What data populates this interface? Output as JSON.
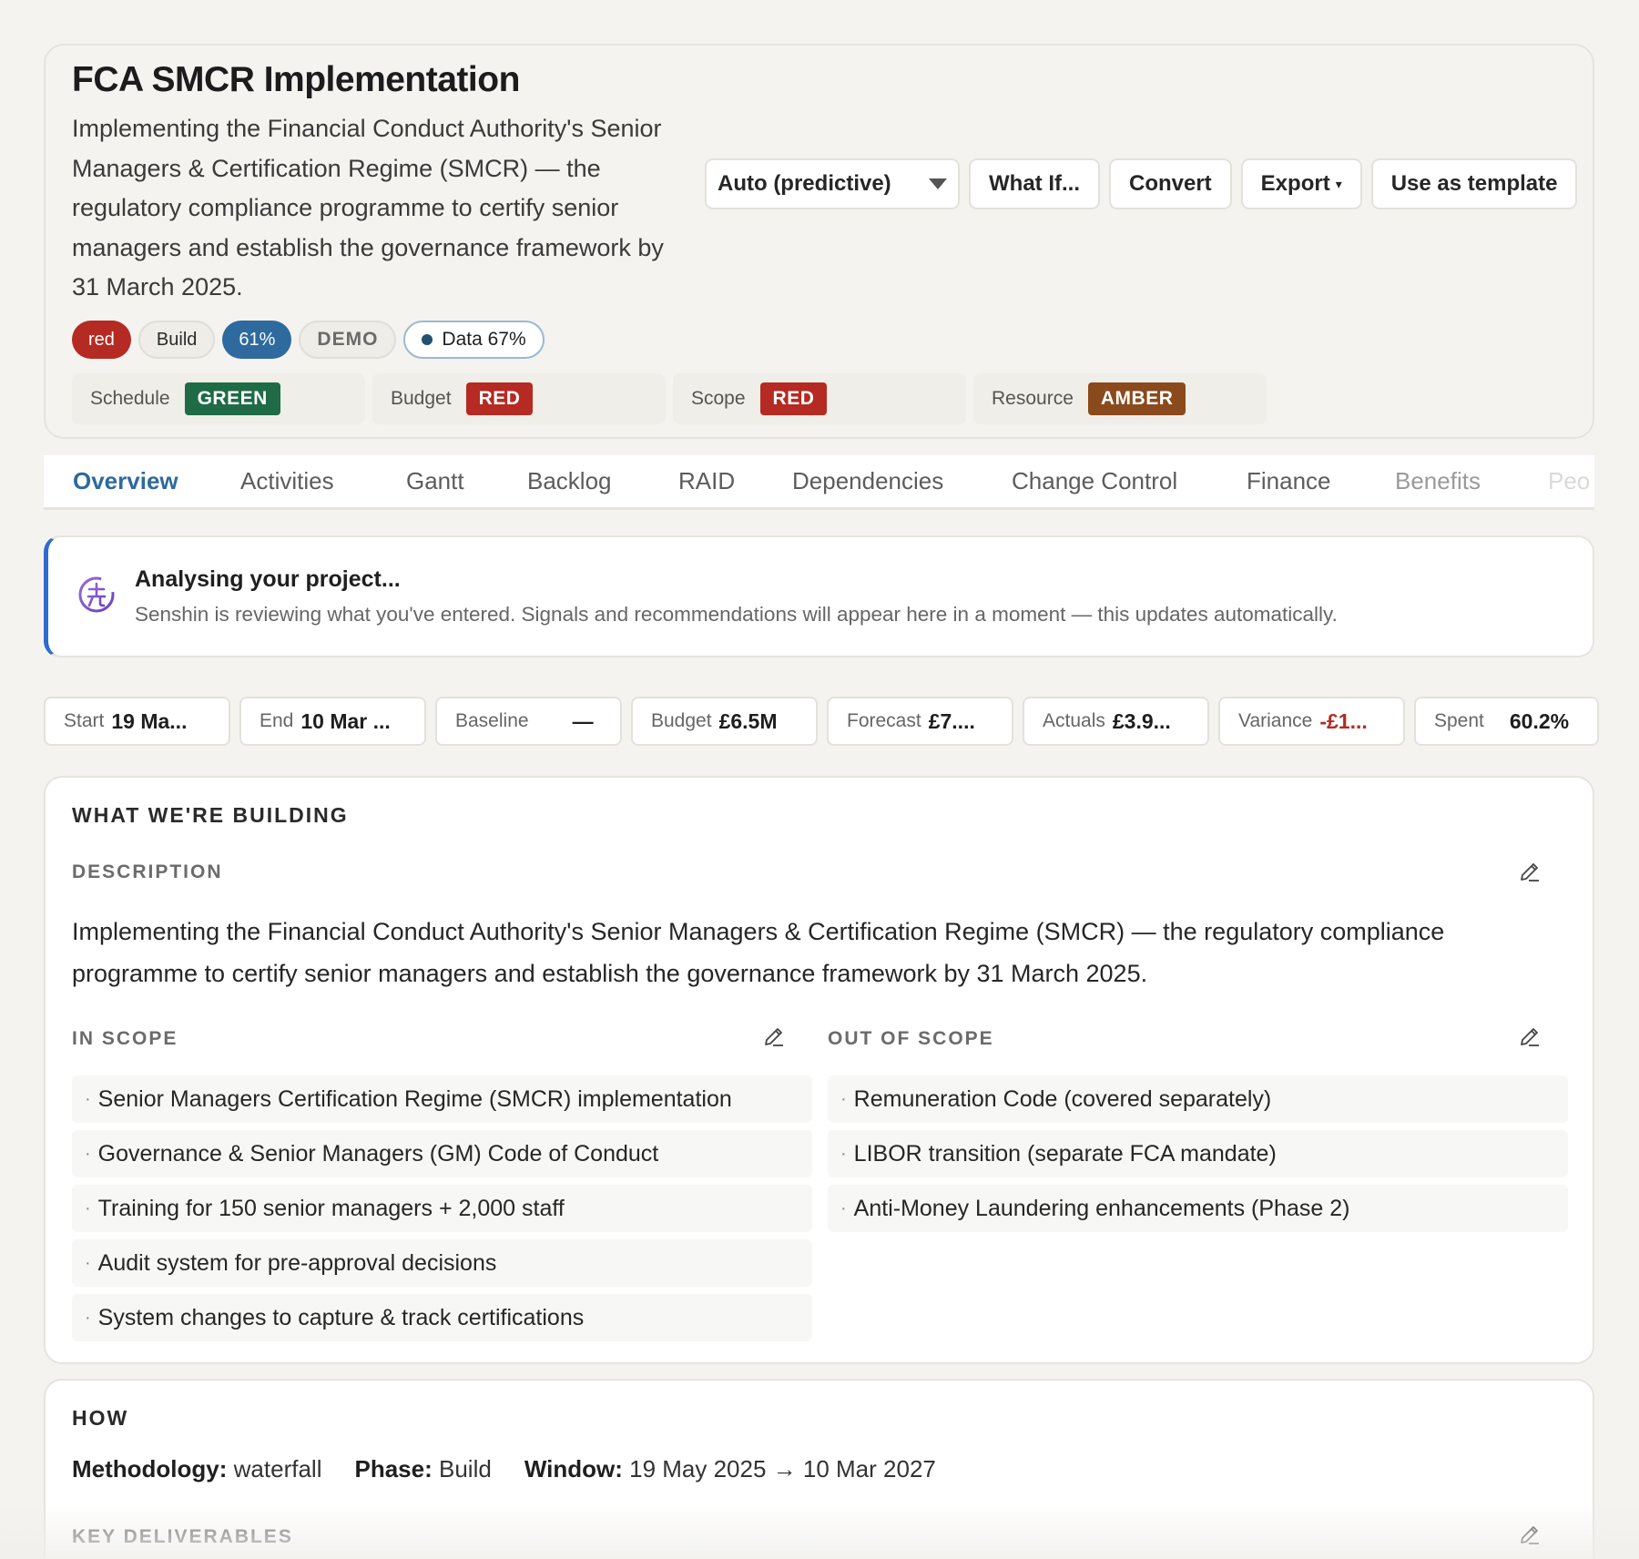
{
  "project": {
    "title": "FCA SMCR Implementation",
    "description": "Implementing the Financial Conduct Authority's Senior Managers & Certification Regime (SMCR) — the regulatory compliance programme to certify senior managers and establish the governance framework by 31 March 2025."
  },
  "toolbar": {
    "mode_select": "Auto (predictive)",
    "what_if": "What If...",
    "convert": "Convert",
    "export": "Export",
    "export_caret": "▾",
    "use_template": "Use as template"
  },
  "pills": {
    "status": "red",
    "phase": "Build",
    "progress": "61%",
    "demo": "DEMO",
    "data_quality": "Data 67%"
  },
  "rag": [
    {
      "label": "Schedule",
      "value": "GREEN",
      "color": "#1e6b45"
    },
    {
      "label": "Budget",
      "value": "RED",
      "color": "#b52a22"
    },
    {
      "label": "Scope",
      "value": "RED",
      "color": "#b52a22"
    },
    {
      "label": "Resource",
      "value": "AMBER",
      "color": "#8a4a1c"
    }
  ],
  "tabs": [
    "Overview",
    "Activities",
    "Gantt",
    "Backlog",
    "RAID",
    "Dependencies",
    "Change Control",
    "Finance",
    "Benefits",
    "Peo"
  ],
  "banner": {
    "title": "Analysing your project...",
    "text": "Senshin is reviewing what you've entered. Signals and recommendations will appear here in a moment — this updates automatically."
  },
  "metrics": [
    {
      "label": "Start",
      "value": "19 Ma..."
    },
    {
      "label": "End",
      "value": "10 Mar ..."
    },
    {
      "label": "Baseline",
      "value": "—"
    },
    {
      "label": "Budget",
      "value": "£6.5M"
    },
    {
      "label": "Forecast",
      "value": "£7...."
    },
    {
      "label": "Actuals",
      "value": "£3.9..."
    },
    {
      "label": "Variance",
      "value": "-£1..."
    },
    {
      "label": "Spent",
      "value": "60.2%"
    }
  ],
  "building": {
    "heading": "WHAT WE'RE BUILDING",
    "description_label": "DESCRIPTION",
    "description": "Implementing the Financial Conduct Authority's Senior Managers & Certification Regime (SMCR) — the regulatory compliance programme to certify senior managers and establish the governance framework by 31 March 2025.",
    "in_scope_label": "IN SCOPE",
    "out_scope_label": "OUT OF SCOPE",
    "in_scope": [
      "Senior Managers Certification Regime (SMCR) implementation",
      "Governance & Senior Managers (GM) Code of Conduct",
      "Training for 150 senior managers + 2,000 staff",
      "Audit system for pre-approval decisions",
      "System changes to capture & track certifications"
    ],
    "out_scope": [
      "Remuneration Code (covered separately)",
      "LIBOR transition (separate FCA mandate)",
      "Anti-Money Laundering enhancements (Phase 2)"
    ]
  },
  "how": {
    "heading": "HOW",
    "methodology_label": "Methodology:",
    "methodology": "waterfall",
    "phase_label": "Phase:",
    "phase": "Build",
    "window_label": "Window:",
    "window": "19 May 2025 → 10 Mar 2027",
    "deliverables_label": "KEY DELIVERABLES"
  },
  "icons": {
    "edit": "pencil-icon",
    "ai": "senshin-logo-icon",
    "caret": "chevron-down-icon"
  }
}
